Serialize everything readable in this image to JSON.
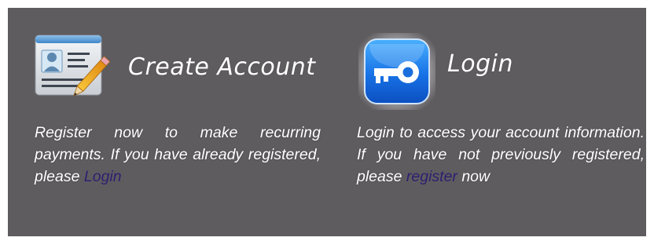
{
  "create_account": {
    "title": "Create Account",
    "text_before_link": "Register now to make recurring payments. If you have already registered, please ",
    "link_label": "Login",
    "icon": "contact-card-pencil-icon"
  },
  "login": {
    "title": "Login",
    "text_before_link": "Login to access your account information. If you have not previously registered, please ",
    "link_label": "register",
    "text_after_link": " now",
    "icon": "key-icon"
  },
  "colors": {
    "background": "#5f5c60",
    "text": "#ffffff",
    "link": "#2e1f6e"
  }
}
